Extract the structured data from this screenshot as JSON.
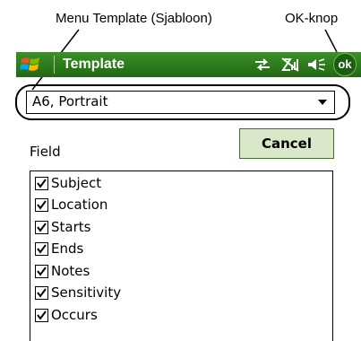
{
  "annotations": {
    "menu_template": "Menu Template (Sjabloon)",
    "ok_knop": "OK-knop"
  },
  "titlebar": {
    "title": "Template",
    "ok_label": "ok",
    "icons": [
      "windows-logo-icon",
      "connectivity-icon",
      "no-signal-icon",
      "speaker-icon"
    ],
    "color": "#2c7a1c"
  },
  "template_select": {
    "value": "A6, Portrait"
  },
  "form": {
    "field_label": "Field",
    "cancel_label": "Cancel"
  },
  "fields": [
    {
      "label": "Subject",
      "checked": true
    },
    {
      "label": "Location",
      "checked": true
    },
    {
      "label": "Starts",
      "checked": true
    },
    {
      "label": "Ends",
      "checked": true
    },
    {
      "label": "Notes",
      "checked": true
    },
    {
      "label": "Sensitivity",
      "checked": true
    },
    {
      "label": "Occurs",
      "checked": true
    }
  ]
}
